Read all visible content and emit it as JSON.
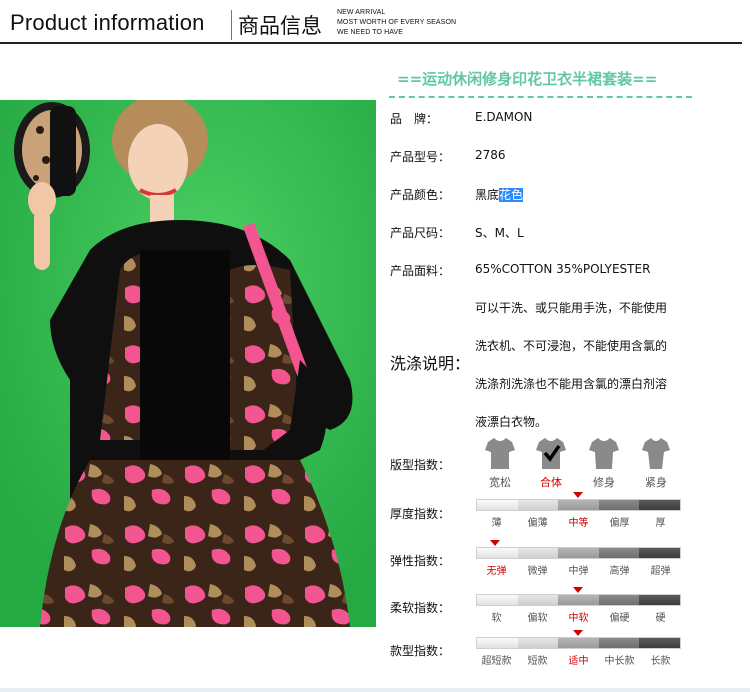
{
  "header": {
    "title_en": "Product information",
    "title_cn": "商品信息",
    "tagline": [
      "NEW ARRIVAL",
      "MOST WORTH OF EVERY SEASON",
      "WE NEED TO HAVE"
    ]
  },
  "product": {
    "title": "==运动休闲修身印花卫衣半裙套装==",
    "fields": [
      {
        "label": "品　牌：",
        "value": "E.DAMON"
      },
      {
        "label": "产品型号：",
        "value": "2786"
      },
      {
        "label": "产品颜色：",
        "value": "黑底",
        "value_highlight": "花色"
      },
      {
        "label": "产品尺码：",
        "value": "S、M、L"
      },
      {
        "label": "产品面料：",
        "value": "65%COTTON 35%POLYESTER"
      }
    ],
    "wash_label": "洗涤说明：",
    "wash_lines": [
      "可以干洗、或只能用手洗，不能使用",
      "洗衣机、不可浸泡，不能使用含氯的",
      "洗涤剂洗涤也不能用含氯的漂白剂溶",
      "液漂白衣物。"
    ]
  },
  "fit": {
    "label": "版型指数：",
    "options": [
      "宽松",
      "合体",
      "修身",
      "紧身"
    ],
    "selected_index": 1
  },
  "indexes": [
    {
      "label": "厚度指数：",
      "options": [
        "薄",
        "偏薄",
        "中等",
        "偏厚",
        "厚"
      ],
      "selected_index": 2
    },
    {
      "label": "弹性指数：",
      "options": [
        "无弹",
        "微弹",
        "中弹",
        "高弹",
        "超弹"
      ],
      "selected_index": 0
    },
    {
      "label": "柔软指数：",
      "options": [
        "软",
        "偏软",
        "中软",
        "偏硬",
        "硬"
      ],
      "selected_index": 2
    },
    {
      "label": "款型指数：",
      "options": [
        "超短款",
        "短款",
        "适中",
        "中长款",
        "长款"
      ],
      "selected_index": 2
    }
  ],
  "colors": {
    "accent": "#62c6a9",
    "selected": "#d10000",
    "highlight": "#2e89ff",
    "photo_bg": "#2fbf50"
  }
}
